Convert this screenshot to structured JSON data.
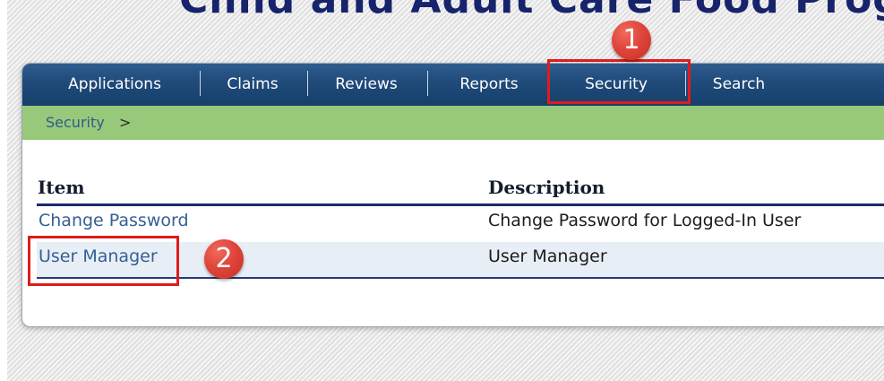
{
  "site": {
    "title": "Child and Adult Care Food Program"
  },
  "nav": {
    "items": [
      {
        "label": "Applications"
      },
      {
        "label": "Claims"
      },
      {
        "label": "Reviews"
      },
      {
        "label": "Reports"
      },
      {
        "label": "Security",
        "active": true
      },
      {
        "label": "Search"
      }
    ]
  },
  "breadcrumb": {
    "current": "Security",
    "separator": ">"
  },
  "table": {
    "columns": [
      "Item",
      "Description"
    ],
    "rows": [
      {
        "item": "Change Password",
        "description": "Change Password for Logged-In User"
      },
      {
        "item": "User Manager",
        "description": "User Manager"
      }
    ]
  },
  "annotations": {
    "step1": "1",
    "step2": "2"
  },
  "colors": {
    "nav": "#1f4a7a",
    "breadcrumb_bar": "#98c97b",
    "link": "#365f92",
    "highlight": "#e01b1b",
    "badge": "#e0453a"
  }
}
